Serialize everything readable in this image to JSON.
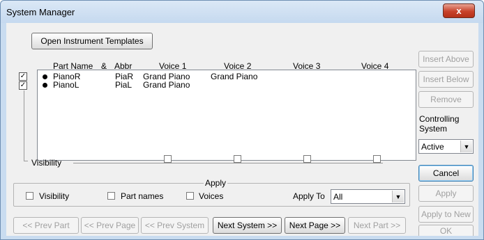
{
  "window": {
    "title": "System Manager",
    "close_glyph": "x"
  },
  "open_templates_button": "Open Instrument Templates",
  "columns": {
    "part_name": "Part Name",
    "amp": "&",
    "abbr": "Abbr",
    "voice1": "Voice 1",
    "voice2": "Voice 2",
    "voice3": "Voice 3",
    "voice4": "Voice 4"
  },
  "parts": [
    {
      "checked": true,
      "name": "PianoR",
      "abbr": "PiaR",
      "voice1": "Grand Piano",
      "voice2": "Grand Piano"
    },
    {
      "checked": true,
      "name": "PianoL",
      "abbr": "PiaL",
      "voice1": "Grand Piano",
      "voice2": ""
    }
  ],
  "visibility_label": "Visibility",
  "side_buttons": {
    "insert_above": "Insert Above",
    "insert_below": "Insert Below",
    "remove": "Remove",
    "controlling_system_label": "Controlling System",
    "controlling_system_value": "Active",
    "cancel": "Cancel",
    "apply": "Apply",
    "apply_to_new": "Apply to New",
    "ok": "OK"
  },
  "apply_group": {
    "title": "Apply",
    "visibility": "Visibility",
    "part_names": "Part names",
    "voices": "Voices",
    "apply_to_label": "Apply To",
    "apply_to_value": "All"
  },
  "nav": {
    "prev_part": "<< Prev Part",
    "prev_page": "<< Prev Page",
    "prev_system": "<< Prev System",
    "next_system": "Next System >>",
    "next_page": "Next Page >>",
    "next_part": "Next Part >>"
  }
}
